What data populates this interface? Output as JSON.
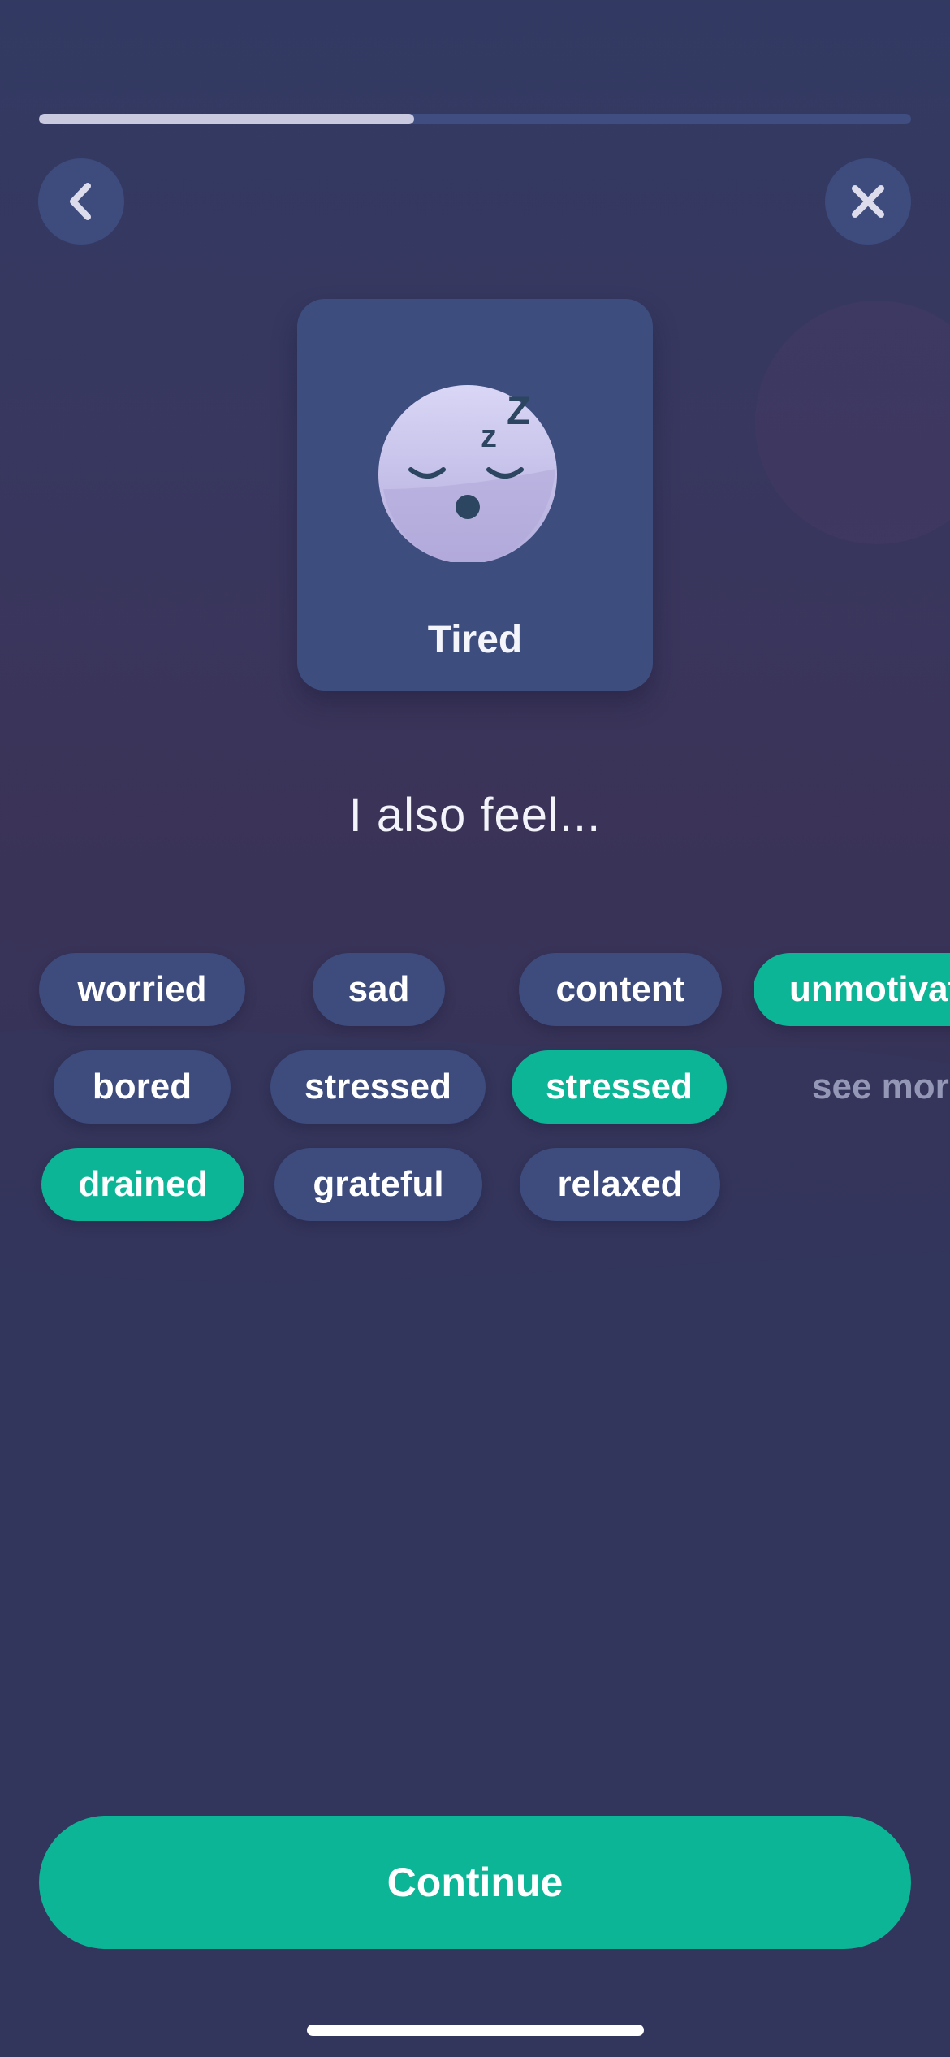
{
  "progress": {
    "fraction": 0.43
  },
  "nav": {
    "back_icon": "chevron-left-icon",
    "close_icon": "close-icon"
  },
  "mood": {
    "label": "Tired",
    "icon": "sleepy-face-icon",
    "sleep_letters": [
      "z",
      "Z"
    ]
  },
  "prompt": "I also feel...",
  "feelings": [
    {
      "label": "worried",
      "selected": false
    },
    {
      "label": "sad",
      "selected": false
    },
    {
      "label": "content",
      "selected": false
    },
    {
      "label": "unmotivated",
      "selected": true
    },
    {
      "label": "bored",
      "selected": false
    },
    {
      "label": "stressed",
      "selected": false
    },
    {
      "label": "stressed",
      "selected": true
    },
    {
      "label": "see more",
      "selected": false
    },
    {
      "label": "drained",
      "selected": true
    },
    {
      "label": "grateful",
      "selected": false
    },
    {
      "label": "relaxed",
      "selected": false
    }
  ],
  "continue_label": "Continue",
  "colors": {
    "accent": "#0cb596",
    "chip": "#3d4b7d",
    "card": "#3d4d7e",
    "background": "#33345b"
  }
}
